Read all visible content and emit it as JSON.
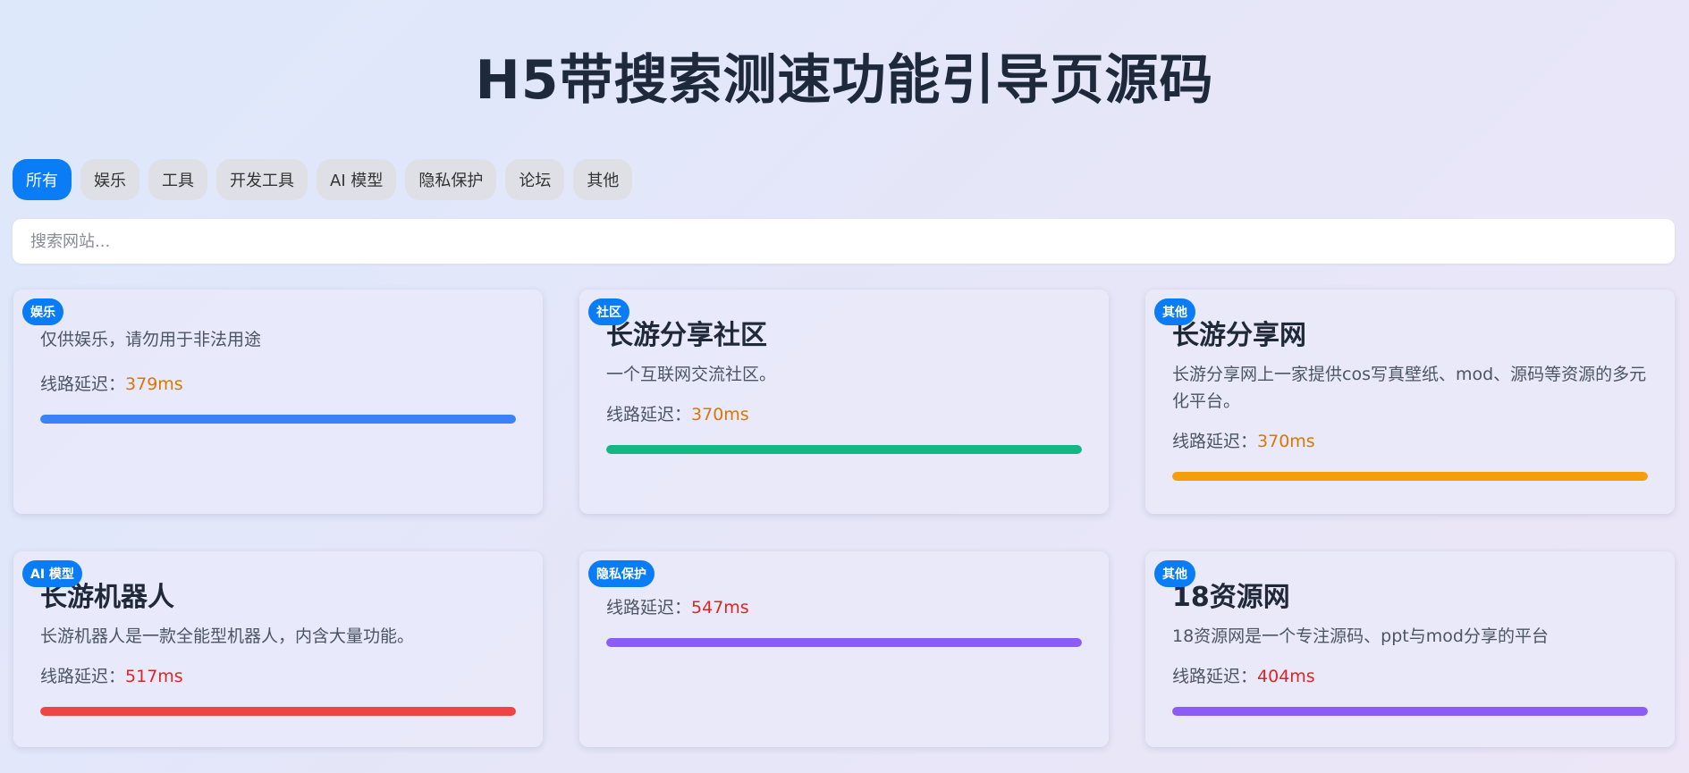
{
  "page_title": "H5带搜索测速功能引导页源码",
  "filters": [
    "所有",
    "娱乐",
    "工具",
    "开发工具",
    "AI 模型",
    "隐私保护",
    "论坛",
    "其他"
  ],
  "active_filter": "所有",
  "search": {
    "placeholder": "搜索网站...",
    "value": ""
  },
  "latency_label": "线路延迟：",
  "cards": [
    {
      "badge": "娱乐",
      "title": "",
      "desc": "仅供娱乐，请勿用于非法用途",
      "latency": "379ms",
      "bar_color": "#3b82f6",
      "progress": 1.0
    },
    {
      "badge": "社区",
      "title": "长游分享社区",
      "desc": "一个互联网交流社区。",
      "latency": "370ms",
      "bar_color": "#10b981",
      "progress": 1.0
    },
    {
      "badge": "其他",
      "title": "长游分享网",
      "desc": "长游分享网上一家提供cos写真壁纸、mod、源码等资源的多元化平台。",
      "latency": "370ms",
      "bar_color": "#f59e0b",
      "progress": 1.0
    },
    {
      "badge": "AI 模型",
      "title": "长游机器人",
      "desc": "长游机器人是一款全能型机器人，内含大量功能。",
      "latency": "517ms",
      "bar_color": "#ef4444",
      "progress": 1.0
    },
    {
      "badge": "隐私保护",
      "title": "",
      "desc": "",
      "latency": "547ms",
      "bar_color": "#8b5cf6",
      "progress": 1.0
    },
    {
      "badge": "其他",
      "title": "18资源网",
      "desc": "18资源网是一个专注源码、ppt与mod分享的平台",
      "latency": "404ms",
      "bar_color": "#8b5cf6",
      "progress": 1.0
    }
  ]
}
